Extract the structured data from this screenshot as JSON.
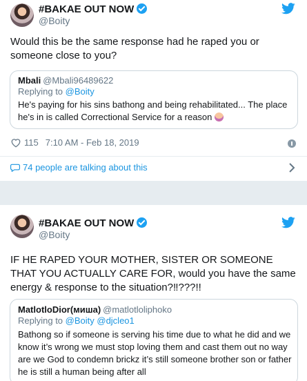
{
  "tweet1": {
    "name": "#BAKAE OUT NOW",
    "handle": "@Boity",
    "text": "Would this be the same response had he raped you or someone close to you?",
    "quote": {
      "name": "Mbali",
      "handle": "@Mbali96489622",
      "replying_prefix": "Replying to ",
      "replying_to": "@Boity",
      "text": "He's paying for his sins bathong and being rehabilitated... The place he's in is called Correctional Service for a reason"
    },
    "likes": "115",
    "time": "7:10 AM - Feb 18, 2019",
    "talking": "74 people are talking about this"
  },
  "tweet2": {
    "name": "#BAKAE OUT NOW",
    "handle": "@Boity",
    "text": "IF HE RAPED YOUR MOTHER, SISTER OR SOMEONE THAT YOU ACTUALLY CARE FOR, would you have the same energy & response to the situation?‼???!!",
    "quote": {
      "name": "MatlotloDior(миша)",
      "handle": "@matlotloliphoko",
      "replying_prefix": "Replying to ",
      "replying_to": "@Boity @djcleo1",
      "text": "Bathong so if someone is serving his time due to what he did and we know it’s wrong we must stop loving them and cast them out no way are we God to condemn brickz it’s still someone brother son or father he is still a human being after all"
    }
  },
  "colors": {
    "blue": "#1da1f2",
    "link": "#1b95e0",
    "gray": "#657786",
    "separator": "#e6ecf0"
  },
  "icons": [
    "twitter-bird-icon",
    "verified-badge-icon",
    "heart-icon",
    "info-icon",
    "speech-bubble-icon",
    "chevron-right-icon",
    "facepalm-emoji-icon"
  ]
}
